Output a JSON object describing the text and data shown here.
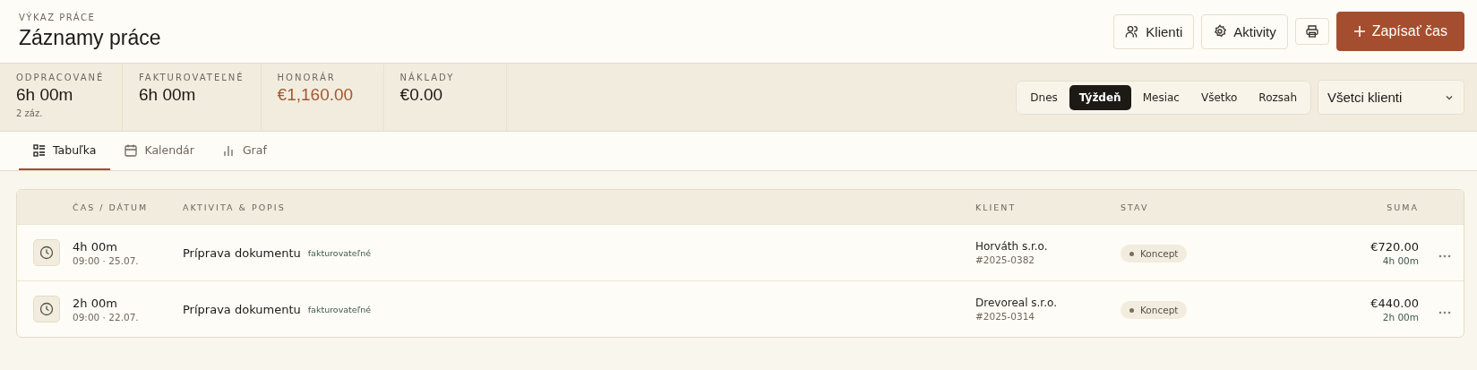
{
  "header": {
    "eyebrow": "VÝKAZ PRÁCE",
    "title": "Záznamy práce",
    "buttons": [
      {
        "kind": "clients",
        "label": "Klienti"
      },
      {
        "kind": "activities",
        "label": "Aktivity"
      },
      {
        "kind": "print"
      },
      {
        "kind": "primary",
        "label": "Zapísať čas"
      }
    ]
  },
  "stats": [
    {
      "label": "ODPRACOVANÉ",
      "value": "6h 00m",
      "note": "2 záz.",
      "highlight": false
    },
    {
      "label": "FAKTUROVATEĽNÉ",
      "value": "6h 00m",
      "highlight": false
    },
    {
      "label": "HONORÁR",
      "value": "€1,160.00",
      "highlight": true
    },
    {
      "label": "NÁKLADY",
      "value": "€0.00",
      "highlight": false
    }
  ],
  "periods": [
    {
      "label": "Dnes",
      "selected": false
    },
    {
      "label": "Týždeň",
      "selected": true
    },
    {
      "label": "Mesiac",
      "selected": false
    },
    {
      "label": "Všetko",
      "selected": false
    },
    {
      "label": "Rozsah",
      "selected": false
    }
  ],
  "client_filter": {
    "value": "Všetci klienti"
  },
  "tabs": [
    {
      "kind": "table",
      "label": "Tabuľka",
      "selected": true
    },
    {
      "kind": "calendar",
      "label": "Kalendár",
      "selected": false
    },
    {
      "kind": "chart",
      "label": "Graf",
      "selected": false
    }
  ],
  "table": {
    "columns": [
      "ČAS / DÁTUM",
      "AKTIVITA & POPIS",
      "KLIENT",
      "STAV",
      "SUMA"
    ],
    "rows": [
      {
        "duration": "4h 00m",
        "when": "09:00 · 25.07.",
        "activity": "Príprava dokumentu",
        "tag": "fakturovateľné",
        "client": "Horváth s.r.o.",
        "ref": "#2025-0382",
        "status": "Koncept",
        "amount": "€720.00",
        "amount_note": "4h 00m"
      },
      {
        "duration": "2h 00m",
        "when": "09:00 · 22.07.",
        "activity": "Príprava dokumentu",
        "tag": "fakturovateľné",
        "client": "Drevoreal s.r.o.",
        "ref": "#2025-0314",
        "status": "Koncept",
        "amount": "€440.00",
        "amount_note": "2h 00m"
      }
    ]
  }
}
